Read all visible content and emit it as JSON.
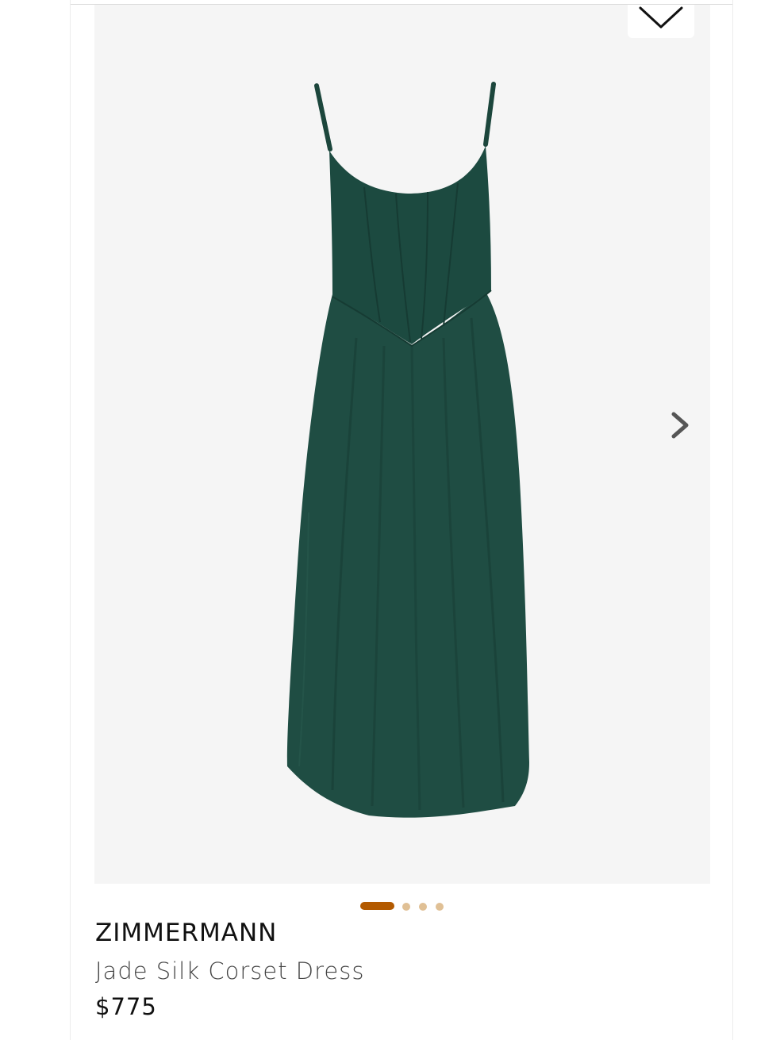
{
  "product": {
    "brand": "ZIMMERMANN",
    "name": "Jade Silk Corset Dress",
    "price": "$775"
  },
  "gallery": {
    "image_count": 4,
    "active_index": 0,
    "next_icon": "chevron-right-icon",
    "wishlist_icon": "chevron-down-icon"
  },
  "colors": {
    "dress": "#1f4d43",
    "image_background": "#f5f5f5",
    "active_dot": "#b35a00",
    "inactive_dot": "#e0c095"
  }
}
